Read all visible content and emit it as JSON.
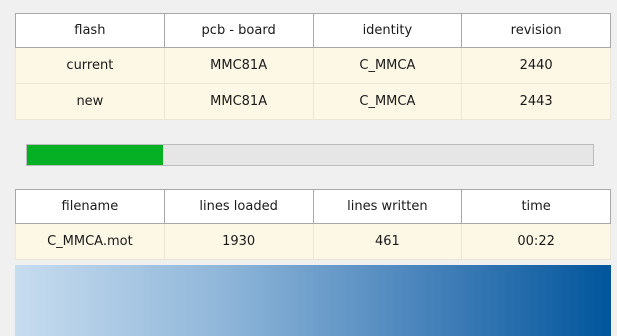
{
  "flash_table": {
    "headers": [
      "flash",
      "pcb - board",
      "identity",
      "revision"
    ],
    "rows": [
      [
        "current",
        "MMC81A",
        "C_MMCA",
        "2440"
      ],
      [
        "new",
        "MMC81A",
        "C_MMCA",
        "2443"
      ]
    ]
  },
  "progress": {
    "fraction": 0.24,
    "color": "#06b025"
  },
  "file_table": {
    "headers": [
      "filename",
      "lines loaded",
      "lines written",
      "time"
    ],
    "rows": [
      [
        "C_MMCA.mot",
        "1930",
        "461",
        "00:22"
      ]
    ]
  },
  "colors": {
    "row_background": "#fdf8e5",
    "header_background": "#ffffff",
    "gradient_start": "#c7dcef",
    "gradient_end": "#00559b"
  }
}
